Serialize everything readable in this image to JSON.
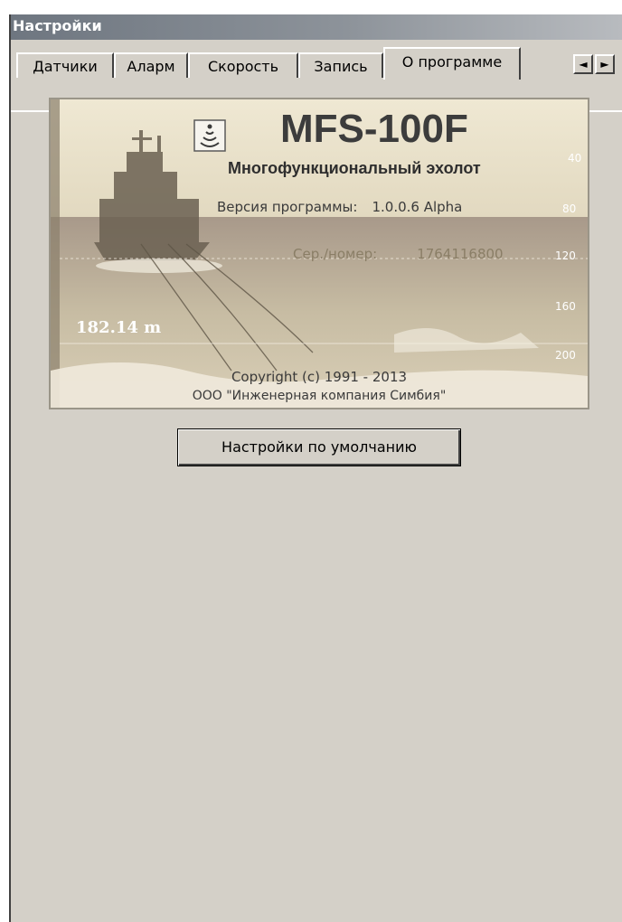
{
  "window": {
    "title": "Настройки"
  },
  "tabs": [
    {
      "label": "Датчики",
      "active": false
    },
    {
      "label": "Аларм",
      "active": false
    },
    {
      "label": "Скорость",
      "active": false
    },
    {
      "label": "Запись",
      "active": false
    },
    {
      "label": "О программе",
      "active": true
    }
  ],
  "tab_scroll": {
    "left_glyph": "◄",
    "right_glyph": "►"
  },
  "about": {
    "app_name": "MFS-100F",
    "app_subtitle": "Многофункциональный эхолот",
    "version_label": "Версия программы:",
    "version_value": "1.0.0.6 Alpha",
    "serial_label": "Сер./номер:",
    "serial_value": "1764116800",
    "depth_reading": "182.14 m",
    "depth_scale": [
      "40",
      "80",
      "120",
      "160",
      "200"
    ],
    "copyright": "Copyright (c) 1991 - 2013",
    "company": "ООО \"Инженерная компания Симбия\""
  },
  "buttons": {
    "defaults_label": "Настройки по умолчанию"
  },
  "colors": {
    "panel_background": "#d4d0c8",
    "titlebar": "#7b828a",
    "splash_tint": "#e3dbc4"
  }
}
